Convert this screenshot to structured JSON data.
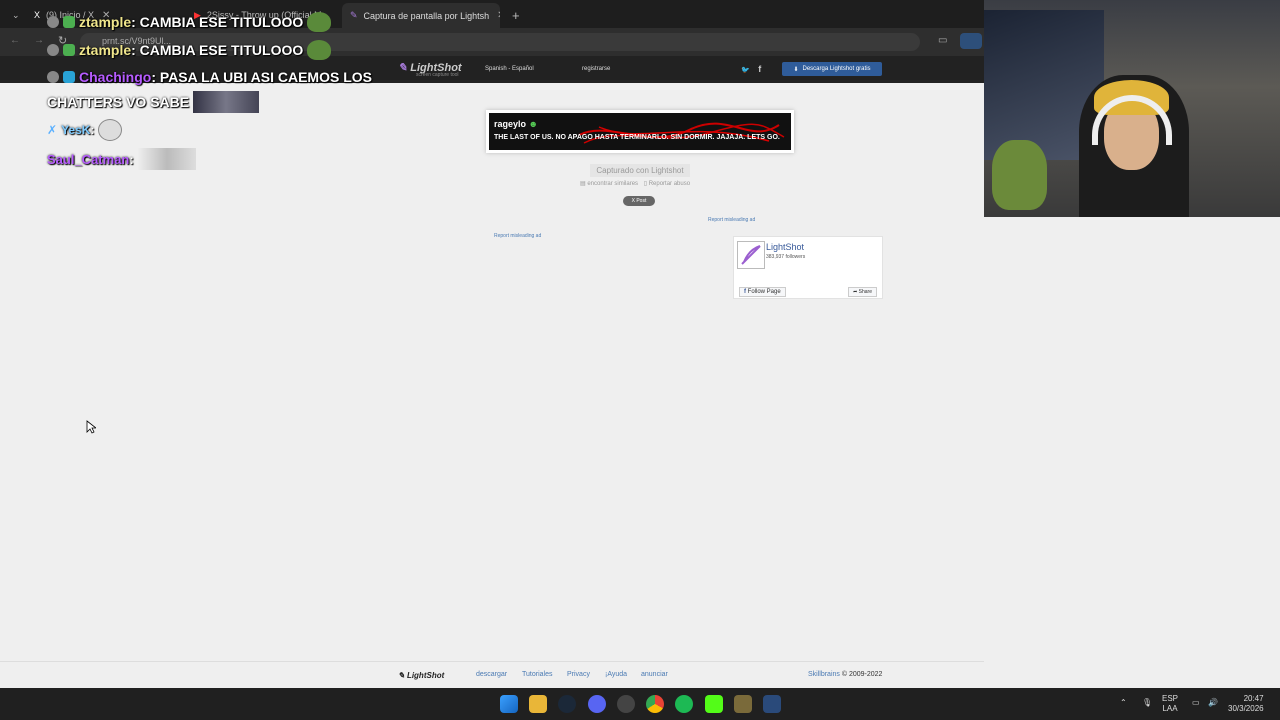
{
  "browser": {
    "tabs": [
      {
        "label": "(9) Inicio / X"
      },
      {
        "label": "2Sissy - Throw up (Official M..."
      },
      {
        "label": "Captura de pantalla por Lightsh"
      }
    ],
    "new_tab": "+",
    "url": "prnt.sc/V9nt9Ul..."
  },
  "header": {
    "logo": "LightShot",
    "logo_sub": "screen capture tool",
    "language": "Spanish - Español",
    "register": "registrarse",
    "social_twitter": "🐦",
    "social_facebook": "f",
    "download_button": "Descarga Lightshot gratis"
  },
  "chat": [
    {
      "user": "ztample",
      "text": ": CAMBIA ESE TITULOOO",
      "color": "#f0e68c"
    },
    {
      "user": "ztample",
      "text": ": CAMBIA ESE TITULOOO",
      "color": "#f0e68c"
    },
    {
      "user": "Chachingo",
      "text": ": PASA LA UBI ASI CAEMOS LOS",
      "color": "#b75cff"
    },
    {
      "user": "",
      "text": "CHATTERS VO SABE",
      "color": "#fff"
    },
    {
      "user": "YesK",
      "text": ":",
      "color": "#7ecbff"
    },
    {
      "user": "Saul_Catman",
      "text": ":",
      "color": "#b75cff"
    }
  ],
  "preview": {
    "username": "rageylo",
    "message": "THE LAST OF US. NO APAGO HASTA TERMINARLO. SIN DORMIR. JAJAJA. LETS GO."
  },
  "captured": "Capturado con Lightshot",
  "find_similar": "encontrar similares",
  "report_abuse": "Reportar abuso",
  "post_button": "X Post",
  "misleading_1": "Report misleading ad",
  "misleading_2": "Report misleading ad",
  "facebook": {
    "name": "LightShot",
    "followers": "383,937 followers",
    "follow": "Follow Page",
    "share": "Share"
  },
  "footer": {
    "logo": "LightShot",
    "links": [
      "descargar",
      "Tutoriales",
      "Privacy",
      "¡Ayuda",
      "anunciar"
    ],
    "company": "Skillbrains",
    "copyright": "© 2009-2022"
  },
  "taskbar": {
    "lang_top": "ESP",
    "lang_bottom": "LAA",
    "time": "20:47",
    "date": "30/3/2026"
  }
}
